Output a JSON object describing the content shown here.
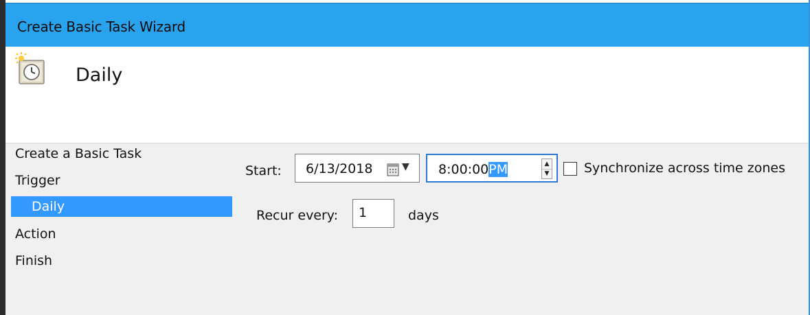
{
  "window": {
    "title": "Create Basic Task Wizard"
  },
  "header": {
    "title": "Daily",
    "icon": "scheduled-task-clock-icon"
  },
  "nav": {
    "items": [
      {
        "label": "Create a Basic Task",
        "selected": false
      },
      {
        "label": "Trigger",
        "selected": false
      },
      {
        "label": "Daily",
        "selected": true
      },
      {
        "label": "Action",
        "selected": false
      },
      {
        "label": "Finish",
        "selected": false
      }
    ]
  },
  "trigger": {
    "start_label": "Start:",
    "start_date": "6/13/2018",
    "start_time_main": "8:00:00",
    "start_time_ampm": "PM",
    "sync_label": "Synchronize across time zones",
    "sync_checked": false,
    "recur_label": "Recur every:",
    "recur_value": "1",
    "recur_unit": "days"
  },
  "colors": {
    "titlebar": "#2aa3ef",
    "selection": "#3399ff",
    "panel": "#f0f0f0"
  }
}
